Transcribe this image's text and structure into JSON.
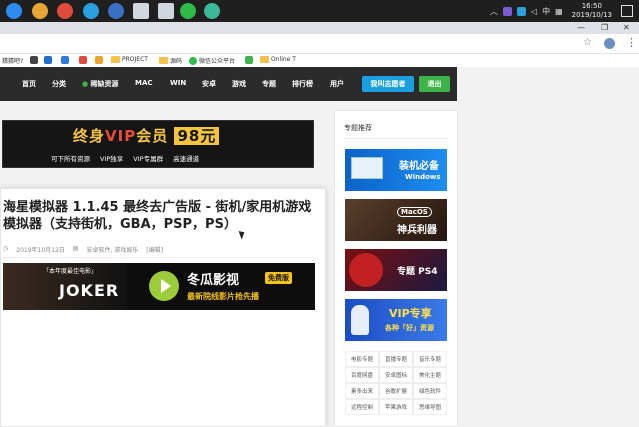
{
  "taskbar": {
    "time": "16:50",
    "date": "2019/10/13",
    "ime": "中"
  },
  "browser": {
    "bookmarks": [
      {
        "label": "猜猜吧?"
      },
      {
        "label": "PROJECT"
      },
      {
        "label": "源码"
      },
      {
        "label": "微信公众平台"
      },
      {
        "label": "Online T"
      }
    ]
  },
  "site": {
    "nav": [
      "首页",
      "分类",
      "稀缺资源",
      "MAC",
      "WIN",
      "安卓",
      "游戏",
      "专题",
      "排行榜",
      "用户"
    ],
    "btn_submit": "我叫志愿者",
    "btn_logout": "退出"
  },
  "banner": {
    "title_a": "终身",
    "title_vip": "VIP",
    "title_b": "会员",
    "title_price": "98元",
    "features": [
      "可下所有资源",
      "VIP独享",
      "VIP专属群",
      "高速通道"
    ]
  },
  "article": {
    "title": "海星模拟器 1.1.45 最终去广告版 - 街机/家用机游戏模拟器（支持街机，GBA，PSP，PS）",
    "date": "2019年10月12日",
    "category": "安卓软件, 游戏娱乐",
    "edit": "[编辑]"
  },
  "ad": {
    "tagline": "「本年度最佳电影」",
    "movie": "JOKER",
    "brand": "冬瓜影视",
    "free_badge": "免费版",
    "slogan": "最新院线影片抢先播"
  },
  "sidebar": {
    "title": "专题推荐",
    "topics": [
      {
        "label": "装机必备",
        "sub": "Windows"
      },
      {
        "label": "神兵利器",
        "sub": "MacOS"
      },
      {
        "label": "专题 PS4",
        "sub": ""
      },
      {
        "label": "VIP专享",
        "sub": "各种「好」资源"
      }
    ],
    "tags": [
      "电影专题",
      "直播专题",
      "音乐专题",
      "百度网盘",
      "安卓图标",
      "美化主题",
      "素多出来",
      "谷歌扩展",
      "绿色软件",
      "远程控制",
      "苹果游戏",
      "思维导图"
    ]
  },
  "colors": {
    "nav_bg": "#2b2b2b",
    "btn_blue": "#1aa0e0",
    "btn_green": "#3db44a",
    "banner_gold": "#f5c542"
  }
}
